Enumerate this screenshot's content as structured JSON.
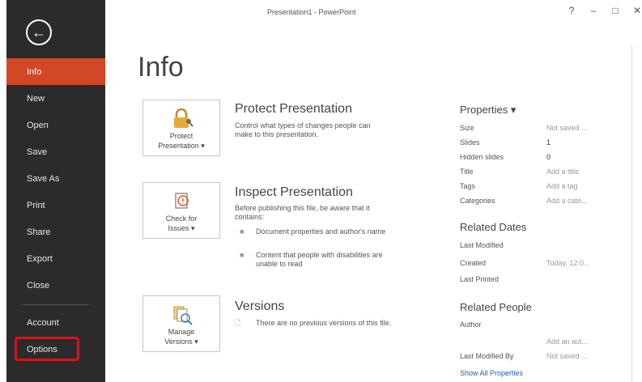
{
  "window": {
    "title": "Presentation1 - PowerPoint",
    "controls": [
      "?",
      "–",
      "□",
      "✕"
    ]
  },
  "sidebar": {
    "back_icon": "back-arrow-circle-icon",
    "items": [
      "Info",
      "New",
      "Open",
      "Save",
      "Save As",
      "Print",
      "Share",
      "Export",
      "Close"
    ],
    "lower_items": [
      "Account",
      "Options"
    ],
    "active": "Info",
    "highlighted": "Options",
    "colors": {
      "background": "#2b2b2b",
      "active": "#d24726",
      "highlight_box": "#d7131e"
    }
  },
  "main": {
    "heading": "Info",
    "protect": {
      "card_line1": "Protect",
      "card_line2": "Presentation ▾",
      "title": "Protect Presentation",
      "desc": "Control what types of changes people can make to this presentation.",
      "icon": "lock-key-icon"
    },
    "inspect": {
      "card_line1": "Check for",
      "card_line2": "Issues ▾",
      "title": "Inspect Presentation",
      "desc": "Before publishing this file, be aware that it contains:",
      "bullets": [
        "Document properties and author's name",
        "Content that people with disabilities are unable to read"
      ],
      "icon": "inspect-document-icon"
    },
    "versions": {
      "card_line1": "Manage",
      "card_line2": "Versions ▾",
      "title": "Versions",
      "desc": "There are no previous versions of this file.",
      "icon": "manage-versions-icon"
    }
  },
  "properties": {
    "heading": "Properties ▾",
    "rows": [
      {
        "label": "Size",
        "value": "Not saved ..."
      },
      {
        "label": "Slides",
        "value": "1"
      },
      {
        "label": "Hidden slides",
        "value": "0"
      },
      {
        "label": "Title",
        "value": "Add a title"
      },
      {
        "label": "Tags",
        "value": "Add a tag"
      },
      {
        "label": "Categories",
        "value": "Add a cate..."
      }
    ],
    "related_dates": {
      "heading": "Related Dates",
      "rows": [
        {
          "label": "Last Modified",
          "value": ""
        },
        {
          "label": "Created",
          "value": "Today, 12:0..."
        },
        {
          "label": "Last Printed",
          "value": ""
        }
      ]
    },
    "related_people": {
      "heading": "Related People",
      "author_label": "Author",
      "add_author": "Add an aut...",
      "last_modified_by_label": "Last Modified By",
      "last_modified_by_value": "Not saved ...",
      "show_all": "Show All Properties"
    }
  }
}
